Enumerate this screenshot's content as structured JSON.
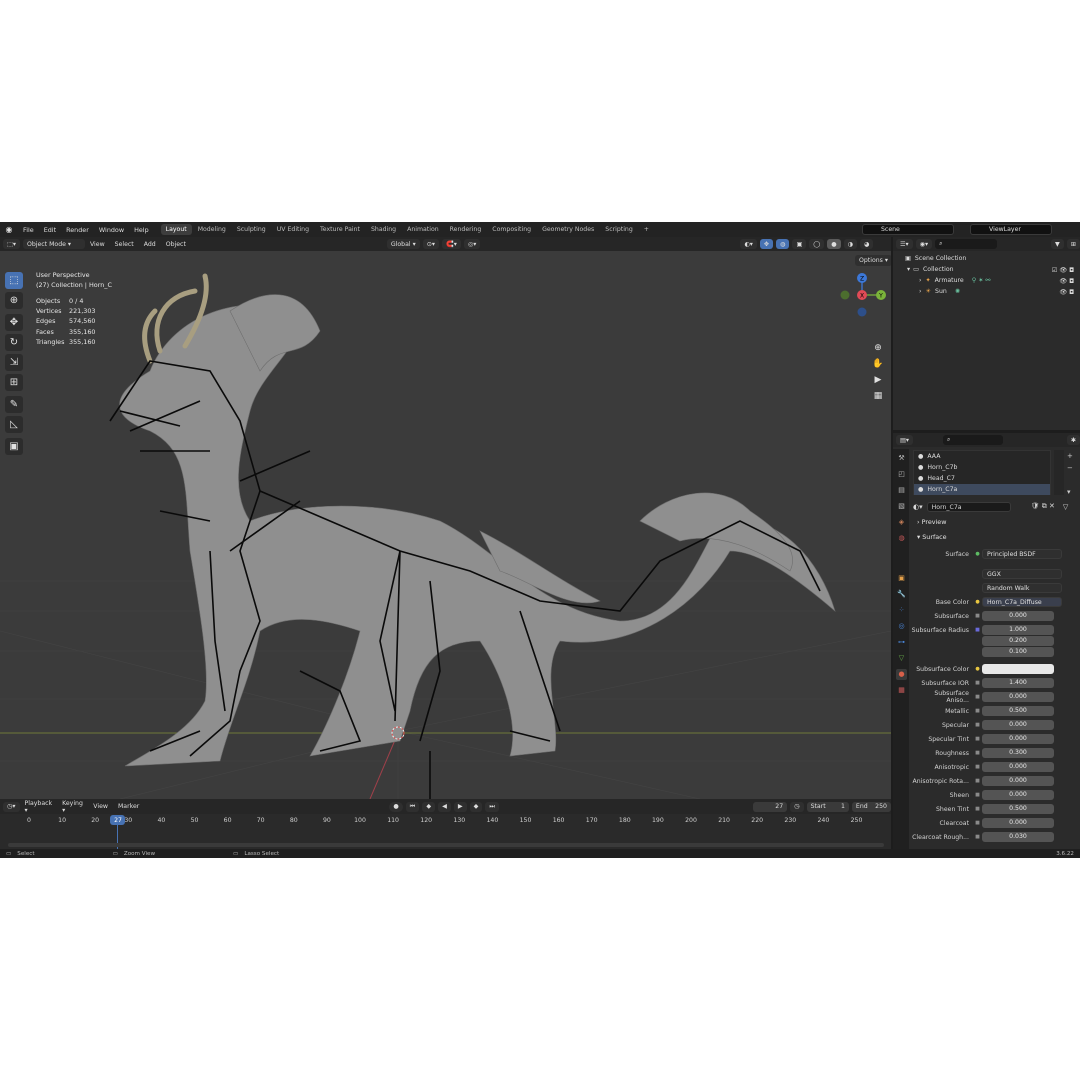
{
  "menu": {
    "items": [
      "File",
      "Edit",
      "Render",
      "Window",
      "Help"
    ],
    "workspaces": [
      "Layout",
      "Modeling",
      "Sculpting",
      "UV Editing",
      "Texture Paint",
      "Shading",
      "Animation",
      "Rendering",
      "Compositing",
      "Geometry Nodes",
      "Scripting"
    ],
    "active_workspace": "Layout",
    "add_tab": "+",
    "scene": "Scene",
    "view_layer": "ViewLayer"
  },
  "viewport_header": {
    "mode": "Object Mode",
    "menus": [
      "View",
      "Select",
      "Add",
      "Object"
    ],
    "orientation": "Global",
    "options": "Options"
  },
  "viewport": {
    "perspective": "User Perspective",
    "collection_info": "(27) Collection | Horn_C",
    "stats": [
      {
        "label": "Objects",
        "value": "0 / 4"
      },
      {
        "label": "Vertices",
        "value": "221,303"
      },
      {
        "label": "Edges",
        "value": "574,560"
      },
      {
        "label": "Faces",
        "value": "355,160"
      },
      {
        "label": "Triangles",
        "value": "355,160"
      }
    ],
    "gizmo": {
      "x": "X",
      "y": "Y",
      "z": "Z"
    }
  },
  "timeline": {
    "menus": [
      "Playback",
      "Keying",
      "View",
      "Marker"
    ],
    "current_frame": "27",
    "start_label": "Start",
    "start": "1",
    "end_label": "End",
    "end": "250",
    "ticks": [
      "0",
      "10",
      "20",
      "30",
      "40",
      "50",
      "60",
      "70",
      "80",
      "90",
      "100",
      "110",
      "120",
      "130",
      "140",
      "150",
      "160",
      "170",
      "180",
      "190",
      "200",
      "210",
      "220",
      "230",
      "240",
      "250"
    ]
  },
  "statusbar": {
    "select": "Select",
    "zoom": "Zoom View",
    "lasso": "Lasso Select",
    "version": "3.6.22"
  },
  "outliner": {
    "root": "Scene Collection",
    "collection": "Collection",
    "objects": [
      "Armature",
      "Sun"
    ]
  },
  "properties": {
    "slots": [
      "AAA",
      "Horn_C7b",
      "Head_C7",
      "Horn_C7a"
    ],
    "selected_slot": "Horn_C7a",
    "material_name": "Horn_C7a",
    "preview_label": "Preview",
    "surface_section": "Surface",
    "surface_label": "Surface",
    "surface_value": "Principled BSDF",
    "distribution": "GGX",
    "subsurface_method": "Random Walk",
    "base_color_label": "Base Color",
    "base_color_value": "Horn_C7a_Diffuse",
    "fields": [
      {
        "label": "Subsurface",
        "value": "0.000",
        "fill": 0
      },
      {
        "label": "Subsurface Radius",
        "value": "1.000",
        "fill": 0
      },
      {
        "label": "",
        "value": "0.200",
        "fill": 0
      },
      {
        "label": "",
        "value": "0.100",
        "fill": 0
      },
      {
        "label": "Subsurface Color",
        "value": "",
        "fill": 0
      },
      {
        "label": "Subsurface IOR",
        "value": "1.400",
        "fill": 0.1
      },
      {
        "label": "Subsurface Aniso...",
        "value": "0.000",
        "fill": 0
      },
      {
        "label": "Metallic",
        "value": "0.500",
        "fill": 0.5
      },
      {
        "label": "Specular",
        "value": "0.000",
        "fill": 0
      },
      {
        "label": "Specular Tint",
        "value": "0.000",
        "fill": 0
      },
      {
        "label": "Roughness",
        "value": "0.300",
        "fill": 0.3
      },
      {
        "label": "Anisotropic",
        "value": "0.000",
        "fill": 0
      },
      {
        "label": "Anisotropic Rota...",
        "value": "0.000",
        "fill": 0
      },
      {
        "label": "Sheen",
        "value": "0.000",
        "fill": 0
      },
      {
        "label": "Sheen Tint",
        "value": "0.500",
        "fill": 0.5
      },
      {
        "label": "Clearcoat",
        "value": "0.000",
        "fill": 0
      },
      {
        "label": "Clearcoat Rough...",
        "value": "0.030",
        "fill": 0.03
      }
    ]
  },
  "colors": {
    "accent": "#4772b3",
    "x_axis": "#e04a56",
    "y_axis": "#7ab33a",
    "z_axis": "#3c78d8"
  }
}
